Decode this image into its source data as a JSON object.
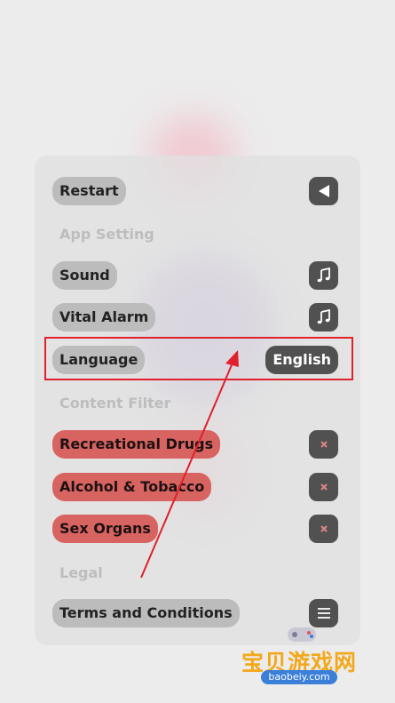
{
  "menu": {
    "restart_label": "Restart",
    "sections": {
      "app_setting": "App Setting",
      "content_filter": "Content Filter",
      "legal": "Legal"
    },
    "sound_label": "Sound",
    "vital_alarm_label": "Vital Alarm",
    "language_label": "Language",
    "language_value": "English",
    "filters": [
      {
        "label": "Recreational Drugs",
        "enabled": false
      },
      {
        "label": "Alcohol & Tobacco",
        "enabled": false
      },
      {
        "label": "Sex Organs",
        "enabled": false
      }
    ],
    "terms_label": "Terms and Conditions"
  },
  "annotation": {
    "color": "#e0202a"
  },
  "watermark": {
    "title": "宝贝游戏网",
    "site": "baobeiy.com"
  },
  "colors": {
    "filter_red": "#d86462",
    "button_dark": "#515151",
    "pill_gray": "#bcbcbc"
  }
}
